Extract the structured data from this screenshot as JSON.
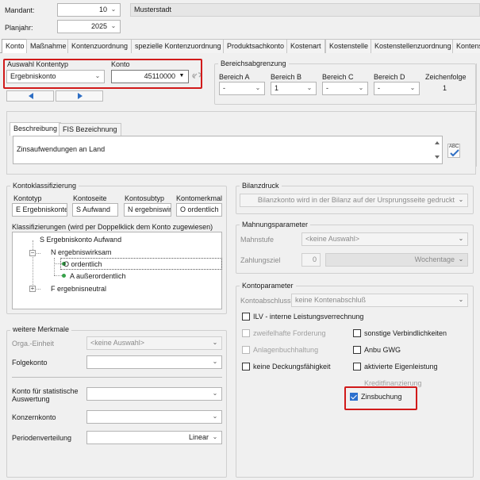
{
  "header": {
    "mandant_label": "Mandant:",
    "mandant_value": "10",
    "mandant_name": "Musterstadt",
    "planjahr_label": "Planjahr:",
    "planjahr_value": "2025"
  },
  "tabs": [
    {
      "label": "Konto",
      "active": true
    },
    {
      "label": "Maßnahme"
    },
    {
      "label": "Kontenzuordnung"
    },
    {
      "label": "spezielle Kontenzuordnung"
    },
    {
      "label": "Produktsachkonto"
    },
    {
      "label": "Kostenart"
    },
    {
      "label": "Kostenstelle"
    },
    {
      "label": "Kostenstellenzuordnung"
    },
    {
      "label": "Kontens"
    }
  ],
  "kontotyp_group": {
    "auswahl_label": "Auswahl Kontentyp",
    "auswahl_value": "Ergebniskonto",
    "konto_label": "Konto",
    "konto_value": "45110000"
  },
  "bereich": {
    "title": "Bereichsabgrenzung",
    "columns": [
      {
        "label": "Bereich A",
        "value": "-"
      },
      {
        "label": "Bereich B",
        "value": "1"
      },
      {
        "label": "Bereich C",
        "value": "-"
      },
      {
        "label": "Bereich D",
        "value": "-"
      }
    ],
    "zeichenfolge_label": "Zeichenfolge",
    "zeichenfolge_value": "1"
  },
  "beschreibung": {
    "tabs": [
      "Beschreibung",
      "FIS Bezeichnung"
    ],
    "text": "Zinsaufwendungen an Land",
    "spell_label": "ABC"
  },
  "kontoklass": {
    "title": "Kontoklassifizierung",
    "headers": [
      "Kontotyp",
      "Kontoseite",
      "Kontosubtyp",
      "Kontomerkmal"
    ],
    "values": [
      "E Ergebniskonter",
      "S Aufwand",
      "N ergebniswir",
      "O ordentlich"
    ],
    "tree_label": "Klassifizierungen (wird per Doppelklick dem Konto zugewiesen)",
    "tree": {
      "root": "S Ergebniskonto Aufwand",
      "level1": "N ergebniswirksam",
      "level2a": "O ordentlich",
      "level2b": "A außerordentlich",
      "level1b": "F ergebnisneutral"
    }
  },
  "weitere": {
    "title": "weitere Merkmale",
    "orga_label": "Orga.-Einheit",
    "orga_value": "<keine Auswahl>",
    "folgekonto_label": "Folgekonto",
    "statkonto_label": "Konto für statistische Auswertung",
    "konzernkonto_label": "Konzernkonto",
    "perioden_label": "Periodenverteilung",
    "perioden_value": "Linear"
  },
  "bilanzdruck": {
    "title": "Bilanzdruck",
    "value": "Bilanzkonto wird in der Bilanz auf der Ursprungsseite gedruckt"
  },
  "mahnung": {
    "title": "Mahnungsparameter",
    "mahnstufe_label": "Mahnstufe",
    "mahnstufe_value": "<keine Auswahl>",
    "zahlungsziel_label": "Zahlungsziel",
    "zahlungsziel_value": "0",
    "wochentage_value": "Wochentage"
  },
  "kontoparam": {
    "title": "Kontoparameter",
    "abschluss_label": "Kontoabschluss",
    "abschluss_value": "keine Kontenabschluß",
    "ilv": "ILV - interne Leistungsverrechnung",
    "zweifelhaft": "zweifelhafte Forderung",
    "sonstige": "sonstige Verbindlichkeiten",
    "anlagen": "Anlagenbuchhaltung",
    "anbu": "Anbu GWG",
    "deckung": "keine Deckungsfähigkeit",
    "aktivierte": "aktivierte Eigenleistung",
    "kredit": "Kreditfinanzierung",
    "zins": "Zinsbuchung"
  },
  "colors": {
    "highlight": "#d11a1a",
    "checkbox_checked": "#2b6fce",
    "nav_arrow": "#2f6fc4"
  }
}
